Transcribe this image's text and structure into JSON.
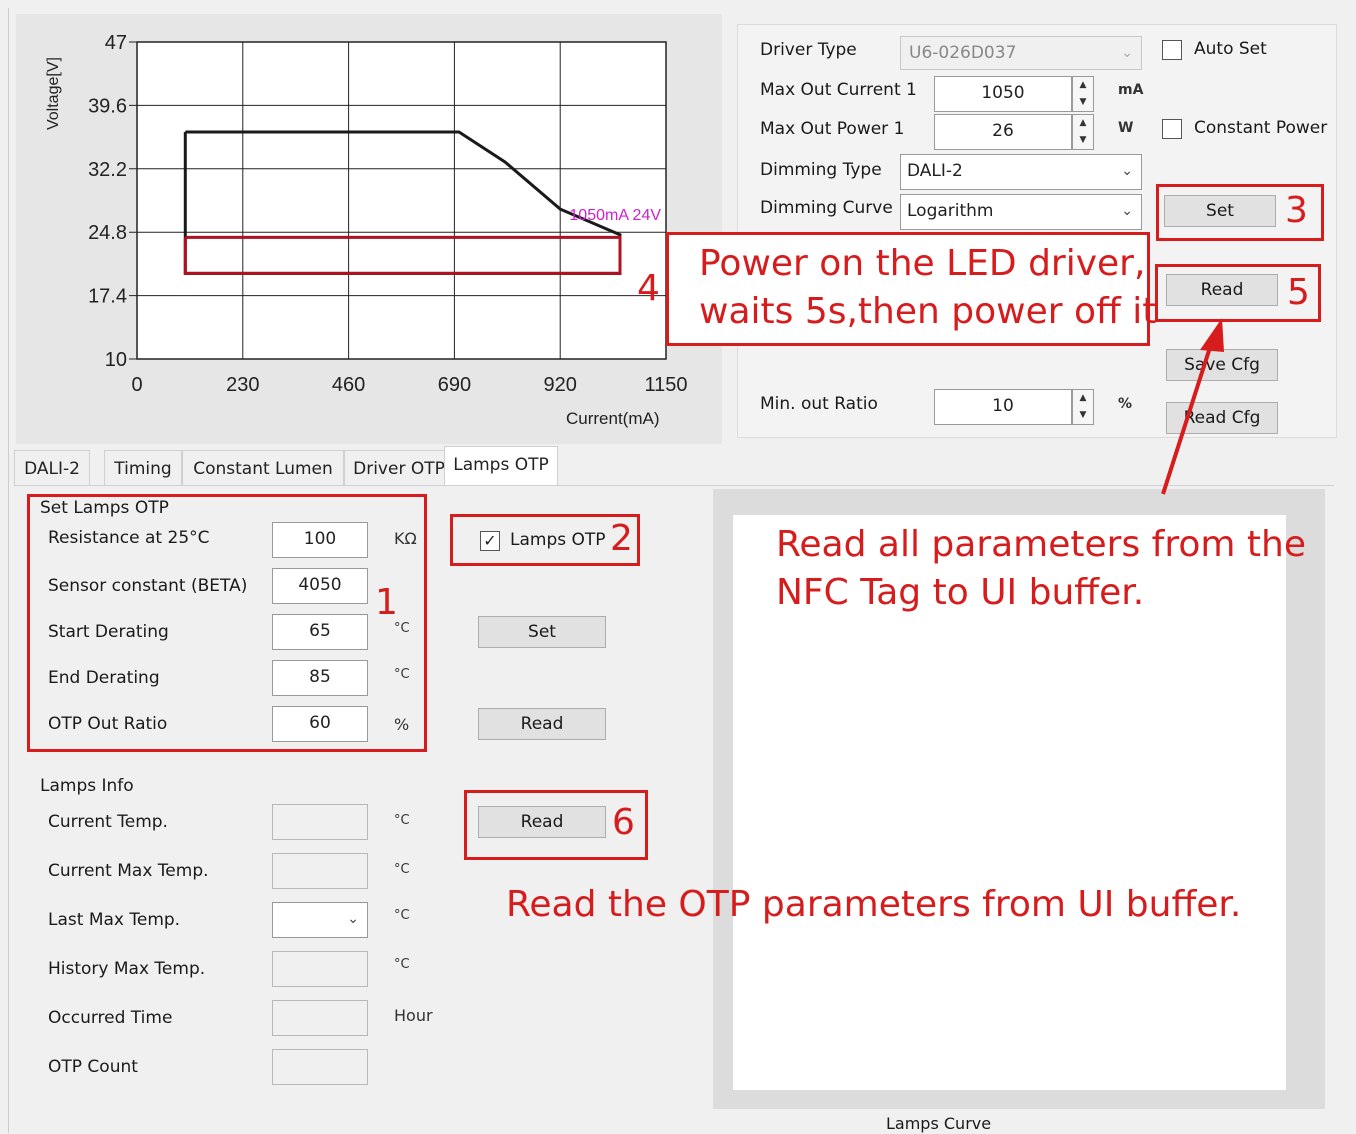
{
  "chart_data": {
    "type": "line",
    "xlabel": "Current(mA)",
    "ylabel": "Voltage[V]",
    "x_ticks": [
      "0",
      "230",
      "460",
      "690",
      "920",
      "1150"
    ],
    "y_ticks": [
      "47",
      "39.6",
      "32.2",
      "24.8",
      "17.4",
      "10"
    ],
    "xlim": [
      0,
      1150
    ],
    "ylim": [
      10,
      47
    ],
    "grid": true,
    "series": [
      {
        "name": "",
        "color": "#1a1a1a",
        "points": [
          [
            105,
            36.5
          ],
          [
            700,
            36.5
          ],
          [
            800,
            33
          ],
          [
            920,
            27.5
          ],
          [
            1050,
            24.5
          ],
          [
            1050,
            20
          ],
          [
            105,
            20
          ],
          [
            105,
            36.5
          ]
        ]
      },
      {
        "name": "",
        "color": "#b01020",
        "points": [
          [
            105,
            24.2
          ],
          [
            1050,
            24.2
          ],
          [
            1050,
            20
          ],
          [
            105,
            20
          ],
          [
            105,
            24.2
          ]
        ]
      }
    ],
    "annotation": "1050mA 24V",
    "annotation_point": [
      940,
      26.2
    ],
    "annotation_color": "#d020d0"
  },
  "params": {
    "driver_type_label": "Driver Type",
    "driver_type_value": "U6-026D037",
    "max_out_current_label": "Max Out Current 1",
    "max_out_current_value": "1050",
    "max_out_current_unit": "mA",
    "max_out_power_label": "Max Out Power 1",
    "max_out_power_value": "26",
    "max_out_power_unit": "W",
    "dimming_type_label": "Dimming Type",
    "dimming_type_value": "DALI-2",
    "dimming_curve_label": "Dimming Curve",
    "dimming_curve_value": "Logarithm",
    "auto_set_label": "Auto Set",
    "constant_power_label": "Constant Power",
    "set_button": "Set",
    "read_button": "Read",
    "save_cfg_button": "Save Cfg",
    "read_cfg_button": "Read Cfg",
    "min_out_ratio_label": "Min. out Ratio",
    "min_out_ratio_value": "10",
    "min_out_ratio_unit": "%"
  },
  "tabs": [
    "DALI-2",
    "Timing",
    "Constant Lumen",
    "Driver OTP",
    "Lamps OTP"
  ],
  "active_tab": "Lamps OTP",
  "set_lamps_otp": {
    "title": "Set Lamps OTP",
    "rows": [
      {
        "label": "Resistance at 25°C",
        "value": "100",
        "unit": "KΩ"
      },
      {
        "label": "Sensor constant (BETA)",
        "value": "4050",
        "unit": ""
      },
      {
        "label": "Start Derating",
        "value": "65",
        "unit": "°C"
      },
      {
        "label": "End Derating",
        "value": "85",
        "unit": "°C"
      },
      {
        "label": "OTP Out Ratio",
        "value": "60",
        "unit": "%"
      }
    ],
    "lamps_otp_checkbox_label": "Lamps OTP",
    "lamps_otp_checked": true,
    "set_button": "Set",
    "read_button": "Read"
  },
  "lamps_info": {
    "title": "Lamps Info",
    "rows": [
      {
        "label": "Current Temp.",
        "unit": "°C"
      },
      {
        "label": "Current Max Temp.",
        "unit": "°C"
      },
      {
        "label": "Last Max Temp.",
        "unit": "°C"
      },
      {
        "label": "History Max Temp.",
        "unit": "°C"
      },
      {
        "label": "Occurred Time",
        "unit": "Hour"
      },
      {
        "label": "OTP Count",
        "unit": ""
      }
    ],
    "read_button": "Read"
  },
  "lamps_curve_label": "Lamps Curve",
  "annotations": {
    "n1": "1",
    "n2": "2",
    "n3": "3",
    "n4": "4",
    "n5": "5",
    "n6": "6",
    "power_line1": "Power on the LED driver,",
    "power_line2": "waits 5s,then power off it",
    "read_nfc_line1": "Read all parameters from the",
    "read_nfc_line2": "NFC Tag to UI buffer.",
    "read_otp": "Read the OTP parameters from UI buffer.",
    "color": "#d61c1c"
  }
}
